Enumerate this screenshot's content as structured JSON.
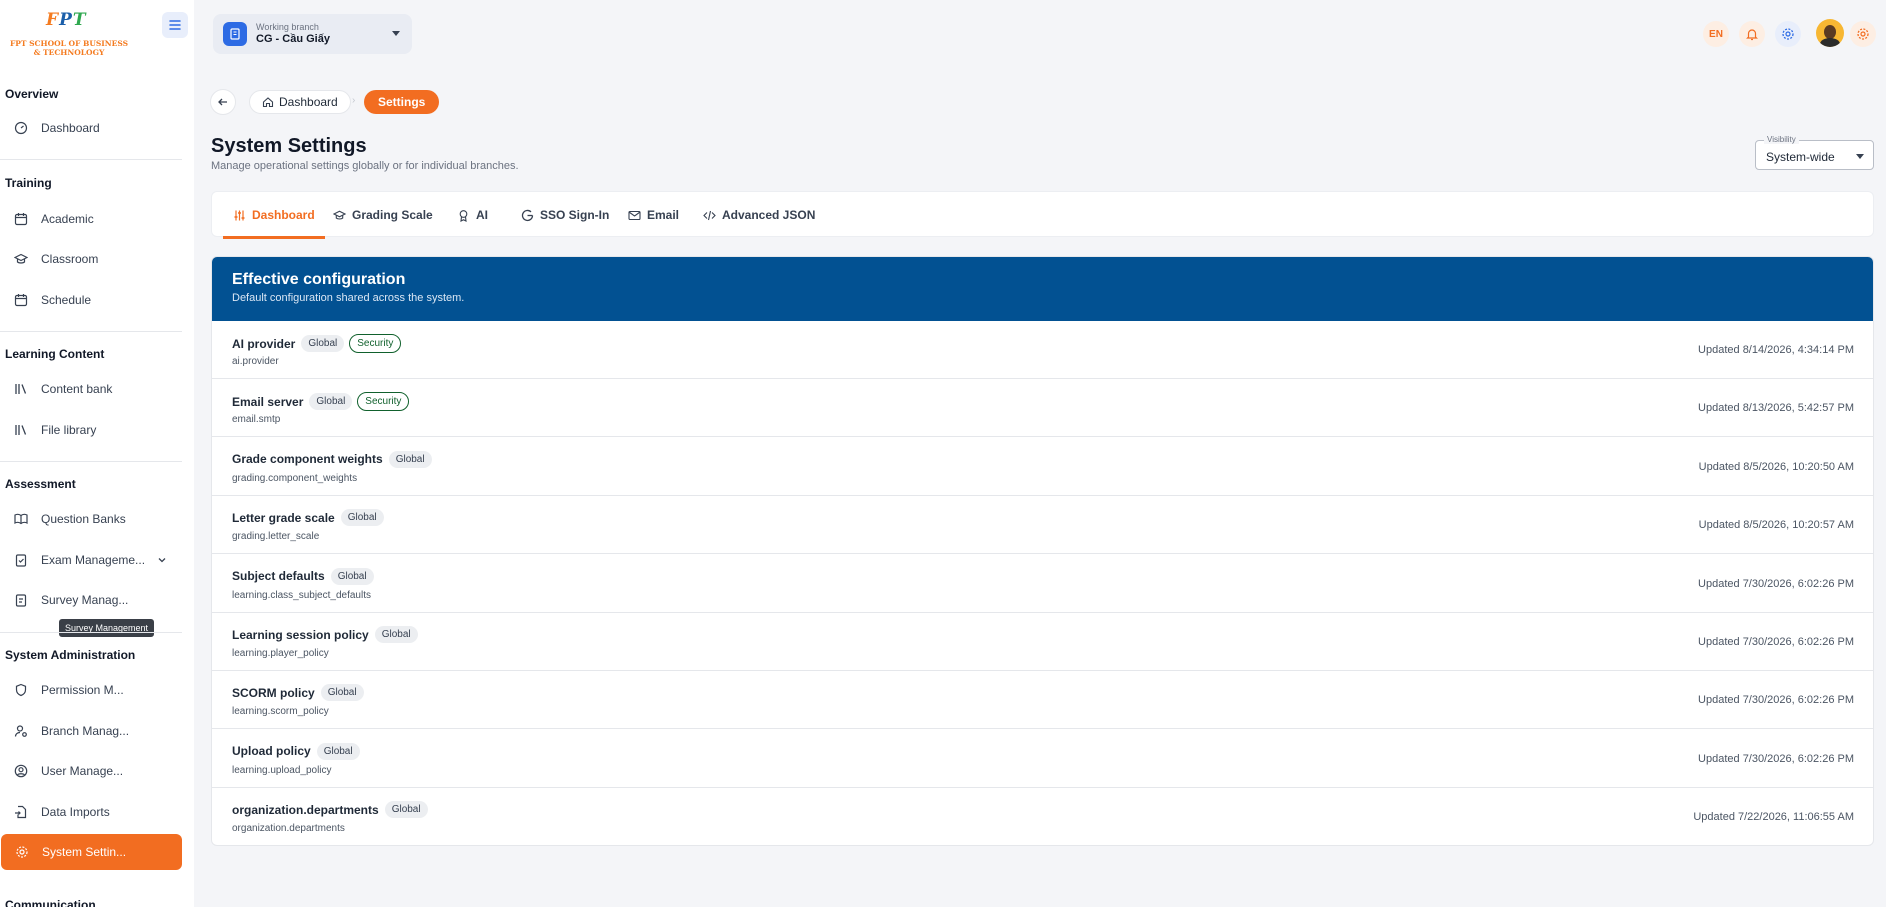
{
  "logo": {
    "mark_f1": "F",
    "mark_p": "P",
    "mark_t": "T",
    "line1": "FPT SCHOOL OF BUSINESS",
    "line2": "& TECHNOLOGY"
  },
  "sidebar": {
    "sections": {
      "overview": "Overview",
      "training": "Training",
      "learning_content": "Learning Content",
      "assessment": "Assessment",
      "system_admin": "System Administration",
      "communication": "Communication"
    },
    "items": {
      "dashboard": "Dashboard",
      "academic": "Academic",
      "classroom": "Classroom",
      "schedule": "Schedule",
      "content_bank": "Content bank",
      "file_library": "File library",
      "question_banks": "Question Banks",
      "exam_management": "Exam Manageme...",
      "survey_management": "Survey Manag...",
      "permission": "Permission M...",
      "branch": "Branch Manag...",
      "user": "User Manage...",
      "data_imports": "Data Imports",
      "system_settings": "System Settin..."
    },
    "tooltip": "Survey Management"
  },
  "header": {
    "branch_label": "Working branch",
    "branch_value": "CG - Cầu Giấy",
    "lang": "EN"
  },
  "breadcrumb": {
    "dashboard": "Dashboard",
    "current": "Settings"
  },
  "page": {
    "title": "System Settings",
    "subtitle": "Manage operational settings globally or for individual branches."
  },
  "visibility": {
    "label": "Visibility",
    "value": "System-wide"
  },
  "tabs": [
    "Dashboard",
    "Grading Scale",
    "AI",
    "SSO Sign-In",
    "Email",
    "Advanced JSON"
  ],
  "card": {
    "title": "Effective configuration",
    "subtitle": "Default configuration shared across the system."
  },
  "rows": [
    {
      "name": "AI provider",
      "badges": [
        "Global",
        "Security"
      ],
      "key": "ai.provider",
      "updated": "Updated 8/14/2026, 4:34:14 PM"
    },
    {
      "name": "Email server",
      "badges": [
        "Global",
        "Security"
      ],
      "key": "email.smtp",
      "updated": "Updated 8/13/2026, 5:42:57 PM"
    },
    {
      "name": "Grade component weights",
      "badges": [
        "Global"
      ],
      "key": "grading.component_weights",
      "updated": "Updated 8/5/2026, 10:20:50 AM"
    },
    {
      "name": "Letter grade scale",
      "badges": [
        "Global"
      ],
      "key": "grading.letter_scale",
      "updated": "Updated 8/5/2026, 10:20:57 AM"
    },
    {
      "name": "Subject defaults",
      "badges": [
        "Global"
      ],
      "key": "learning.class_subject_defaults",
      "updated": "Updated 7/30/2026, 6:02:26 PM"
    },
    {
      "name": "Learning session policy",
      "badges": [
        "Global"
      ],
      "key": "learning.player_policy",
      "updated": "Updated 7/30/2026, 6:02:26 PM"
    },
    {
      "name": "SCORM policy",
      "badges": [
        "Global"
      ],
      "key": "learning.scorm_policy",
      "updated": "Updated 7/30/2026, 6:02:26 PM"
    },
    {
      "name": "Upload policy",
      "badges": [
        "Global"
      ],
      "key": "learning.upload_policy",
      "updated": "Updated 7/30/2026, 6:02:26 PM"
    },
    {
      "name": "organization.departments",
      "badges": [
        "Global"
      ],
      "key": "organization.departments",
      "updated": "Updated 7/22/2026, 11:06:55 AM"
    }
  ],
  "colors": {
    "accent": "#f26d21",
    "header_blue": "#025192",
    "security_green": "#11612d"
  }
}
